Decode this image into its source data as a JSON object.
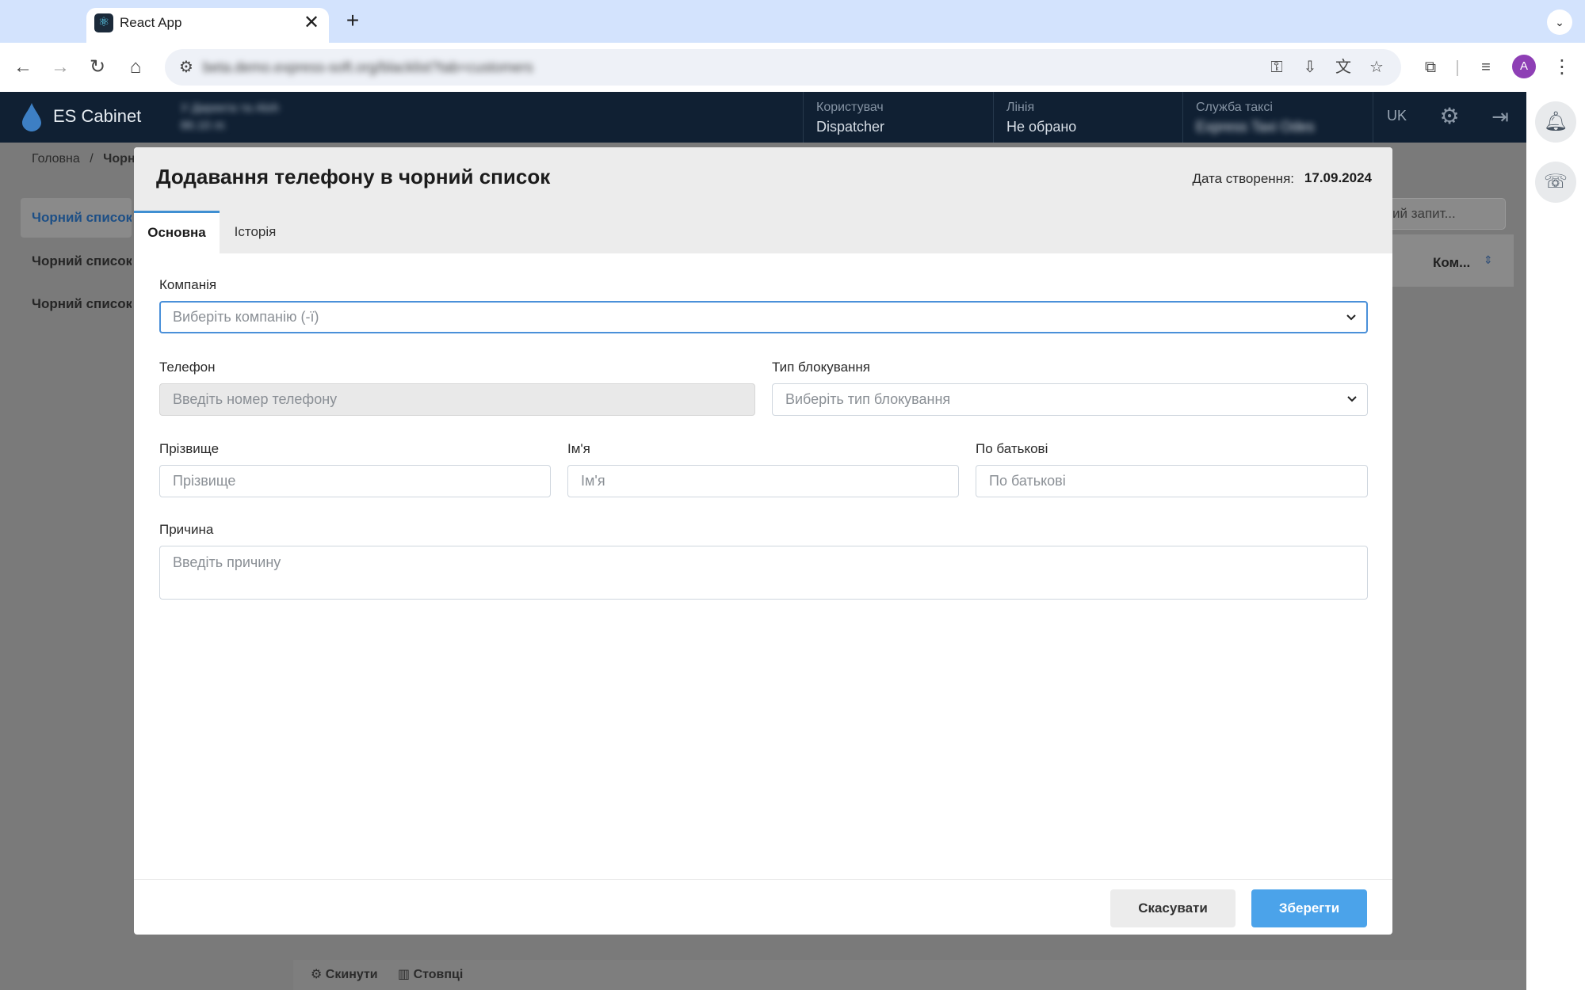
{
  "browser": {
    "tab_title": "React App",
    "tab_close": "✕",
    "new_tab": "+",
    "url": "beta.demo.express-soft.org/blacklist?tab=customers"
  },
  "app": {
    "logo": "ES Cabinet",
    "account_blur_1": "У Директа та Aloh",
    "account_blur_2": "86.10 лг.",
    "user_label": "Користувач",
    "user_value": "Dispatcher",
    "line_label": "Лінія",
    "line_value": "Не обрано",
    "taxi_label": "Служба таксі",
    "taxi_value": "Express Taxi Odes",
    "lang": "UK"
  },
  "background": {
    "breadcrumb_home": "Головна",
    "breadcrumb_sep": "/",
    "breadcrumb_current": "Чорн",
    "sidebar": [
      {
        "label": "Чорний список"
      },
      {
        "label": "Чорний список"
      },
      {
        "label": "Чорний список"
      }
    ],
    "search_partial": "ий запит...",
    "column_partial": "Ком...",
    "footer_reset": "Скинути",
    "footer_columns": "Стовпці"
  },
  "modal": {
    "title": "Додавання телефону в чорний список",
    "date_label": "Дата створення:",
    "date_value": "17.09.2024",
    "tabs": {
      "main": "Основна",
      "history": "Історія"
    },
    "fields": {
      "company": {
        "label": "Компанія",
        "placeholder": "Виберіть компанію (-ї)"
      },
      "phone": {
        "label": "Телефон",
        "placeholder": "Введіть номер телефону"
      },
      "block_type": {
        "label": "Тип блокування",
        "placeholder": "Виберіть тип блокування"
      },
      "surname": {
        "label": "Прізвище",
        "placeholder": "Прізвище"
      },
      "name": {
        "label": "Ім'я",
        "placeholder": "Ім'я"
      },
      "patronymic": {
        "label": "По батькові",
        "placeholder": "По батькові"
      },
      "reason": {
        "label": "Причина",
        "placeholder": "Введіть причину"
      }
    },
    "cancel": "Скасувати",
    "save": "Зберегти"
  },
  "colors": {
    "accent": "#4ba3ea",
    "topbar": "#102033",
    "focus_border": "#4a90d9"
  }
}
